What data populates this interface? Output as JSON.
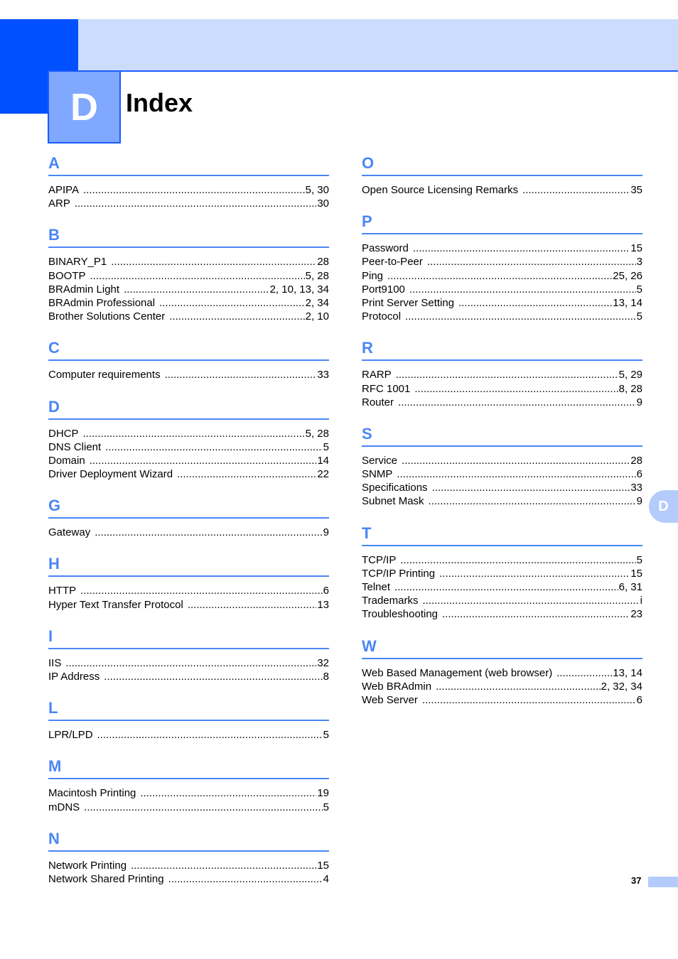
{
  "chapter": {
    "letter": "D",
    "title": "Index"
  },
  "side_tab": "D",
  "page_number": "37",
  "colors": {
    "accent_dark": "#0050ff",
    "accent_light": "#ccdcfc",
    "letter_blue": "#4a86f5",
    "tab_blue": "#b4ccfc"
  },
  "left_column": [
    {
      "letter": "A",
      "entries": [
        {
          "term": "APIPA",
          "pages": "5, 30"
        },
        {
          "term": "ARP",
          "pages": "30"
        }
      ]
    },
    {
      "letter": "B",
      "entries": [
        {
          "term": "BINARY_P1",
          "pages": "28"
        },
        {
          "term": "BOOTP",
          "pages": "5, 28"
        },
        {
          "term": "BRAdmin Light",
          "pages": "2, 10, 13, 34"
        },
        {
          "term": "BRAdmin Professional",
          "pages": "2, 34"
        },
        {
          "term": "Brother Solutions Center",
          "pages": "2, 10"
        }
      ]
    },
    {
      "letter": "C",
      "entries": [
        {
          "term": "Computer requirements",
          "pages": "33"
        }
      ]
    },
    {
      "letter": "D",
      "entries": [
        {
          "term": "DHCP",
          "pages": "5, 28"
        },
        {
          "term": "DNS Client",
          "pages": "5"
        },
        {
          "term": "Domain",
          "pages": "14"
        },
        {
          "term": "Driver Deployment Wizard",
          "pages": "22"
        }
      ]
    },
    {
      "letter": "G",
      "entries": [
        {
          "term": "Gateway",
          "pages": "9"
        }
      ]
    },
    {
      "letter": "H",
      "entries": [
        {
          "term": "HTTP",
          "pages": "6"
        },
        {
          "term": "Hyper Text Transfer Protocol",
          "pages": "13"
        }
      ]
    },
    {
      "letter": "I",
      "entries": [
        {
          "term": "IIS",
          "pages": "32"
        },
        {
          "term": "IP Address",
          "pages": "8"
        }
      ]
    },
    {
      "letter": "L",
      "entries": [
        {
          "term": "LPR/LPD",
          "pages": "5"
        }
      ]
    },
    {
      "letter": "M",
      "entries": [
        {
          "term": "Macintosh Printing",
          "pages": "19"
        },
        {
          "term": "mDNS",
          "pages": "5"
        }
      ]
    },
    {
      "letter": "N",
      "entries": [
        {
          "term": "Network Printing",
          "pages": "15"
        },
        {
          "term": "Network Shared Printing",
          "pages": "4"
        }
      ]
    }
  ],
  "right_column": [
    {
      "letter": "O",
      "entries": [
        {
          "term": "Open Source Licensing Remarks",
          "pages": "35"
        }
      ]
    },
    {
      "letter": "P",
      "entries": [
        {
          "term": "Password",
          "pages": "15"
        },
        {
          "term": "Peer-to-Peer",
          "pages": "3"
        },
        {
          "term": "Ping",
          "pages": "25, 26"
        },
        {
          "term": "Port9100",
          "pages": "5"
        },
        {
          "term": "Print Server Setting",
          "pages": "13, 14"
        },
        {
          "term": "Protocol",
          "pages": "5"
        }
      ]
    },
    {
      "letter": "R",
      "entries": [
        {
          "term": "RARP",
          "pages": "5, 29"
        },
        {
          "term": "RFC 1001",
          "pages": "8, 28"
        },
        {
          "term": "Router",
          "pages": "9"
        }
      ]
    },
    {
      "letter": "S",
      "entries": [
        {
          "term": "Service",
          "pages": "28"
        },
        {
          "term": "SNMP",
          "pages": "6"
        },
        {
          "term": "Specifications",
          "pages": "33"
        },
        {
          "term": "Subnet Mask",
          "pages": "9"
        }
      ]
    },
    {
      "letter": "T",
      "entries": [
        {
          "term": "TCP/IP",
          "pages": "5"
        },
        {
          "term": "TCP/IP Printing",
          "pages": "15"
        },
        {
          "term": "Telnet",
          "pages": "6, 31"
        },
        {
          "term": "Trademarks",
          "pages": "i"
        },
        {
          "term": "Troubleshooting",
          "pages": "23"
        }
      ]
    },
    {
      "letter": "W",
      "entries": [
        {
          "term": "Web Based Management (web browser)",
          "pages": "13, 14"
        },
        {
          "term": "Web BRAdmin",
          "pages": "2, 32, 34"
        },
        {
          "term": "Web Server",
          "pages": "6"
        }
      ]
    }
  ]
}
